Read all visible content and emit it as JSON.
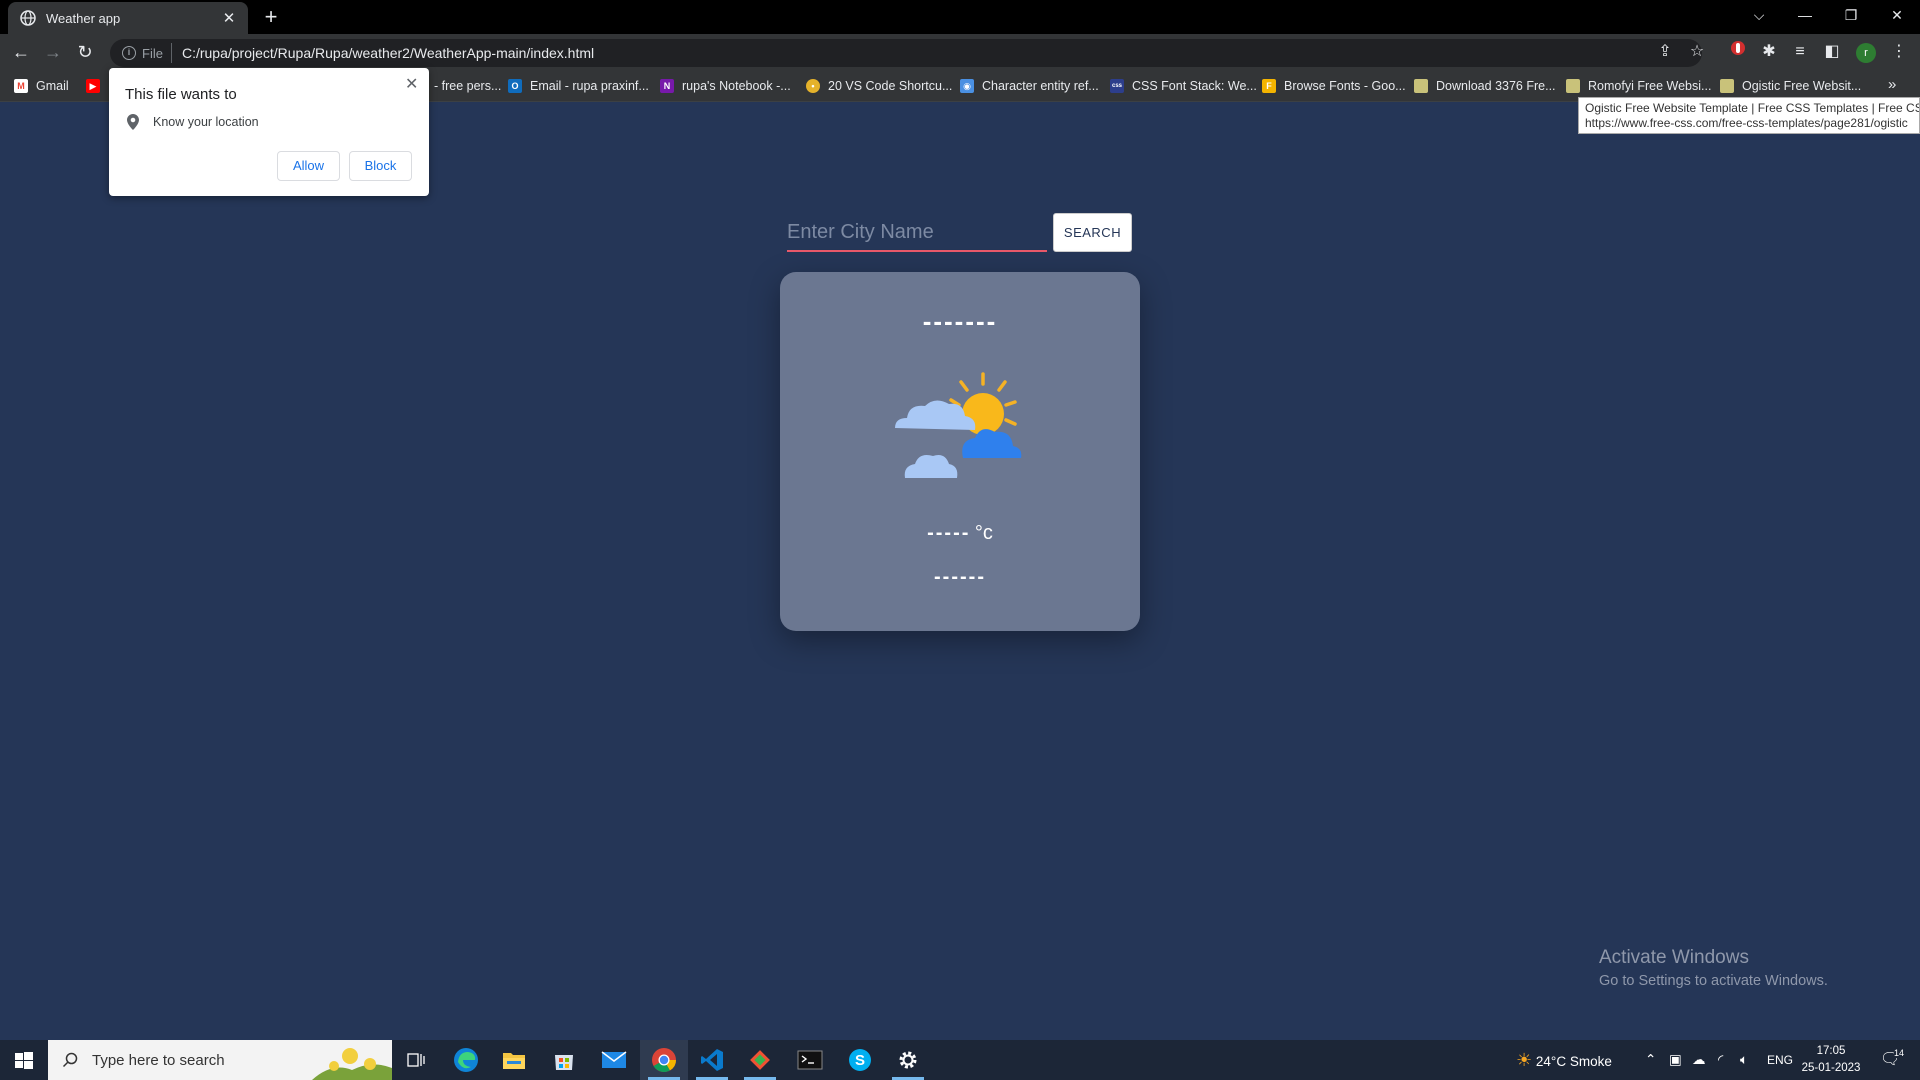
{
  "browser": {
    "tab_title": "Weather app",
    "new_tab_symbol": "+",
    "url_chip": "File",
    "url": "C:/rupa/project/Rupa/Rupa/weather2/WeatherApp-main/index.html",
    "profile_initial": "r"
  },
  "bookmarks": [
    {
      "label": "Gmail",
      "icon": "gmail-icon",
      "color": "#ea4335"
    },
    {
      "label": "",
      "icon": "youtube-icon",
      "color": "#ff0000"
    },
    {
      "label": "- free pers...",
      "icon": "",
      "color": ""
    },
    {
      "label": "Email - rupa praxinf...",
      "icon": "outlook-icon",
      "color": "#0f6cbd"
    },
    {
      "label": "rupa's Notebook -...",
      "icon": "onenote-icon",
      "color": "#7719aa"
    },
    {
      "label": "20 VS Code Shortcu...",
      "icon": "vscode-shortcut-icon",
      "color": "#e5b22b"
    },
    {
      "label": "Character entity ref...",
      "icon": "wiki-icon",
      "color": "#4a90e2"
    },
    {
      "label": "CSS Font Stack: We...",
      "icon": "cssfont-icon",
      "color": "#2d3e8c"
    },
    {
      "label": "Browse Fonts - Goo...",
      "icon": "googlefonts-icon",
      "color": "#f4b400"
    },
    {
      "label": "Download 3376 Fre...",
      "icon": "page-icon",
      "color": "#c9c27a"
    },
    {
      "label": "Romofyi Free Websi...",
      "icon": "page-icon",
      "color": "#c9c27a"
    },
    {
      "label": "Ogistic Free Websit...",
      "icon": "page-icon",
      "color": "#c9c27a"
    }
  ],
  "tooltip": {
    "line1": "Ogistic Free Website Template | Free CSS Templates | Free CSS",
    "line2": "https://www.free-css.com/free-css-templates/page281/ogistic"
  },
  "permission_popup": {
    "title": "This file wants to",
    "request": "Know your location",
    "allow_label": "Allow",
    "block_label": "Block"
  },
  "app": {
    "search_placeholder": "Enter City Name",
    "search_button": "SEARCH",
    "city": "-------",
    "temperature": "-----",
    "temp_unit": "°c",
    "description": "------"
  },
  "watermark": {
    "line1": "Activate Windows",
    "line2": "Go to Settings to activate Windows."
  },
  "taskbar": {
    "search_placeholder": "Type here to search",
    "weather": "24°C  Smoke",
    "language": "ENG",
    "time": "17:05",
    "date": "25-01-2023",
    "notification_count": "14"
  }
}
